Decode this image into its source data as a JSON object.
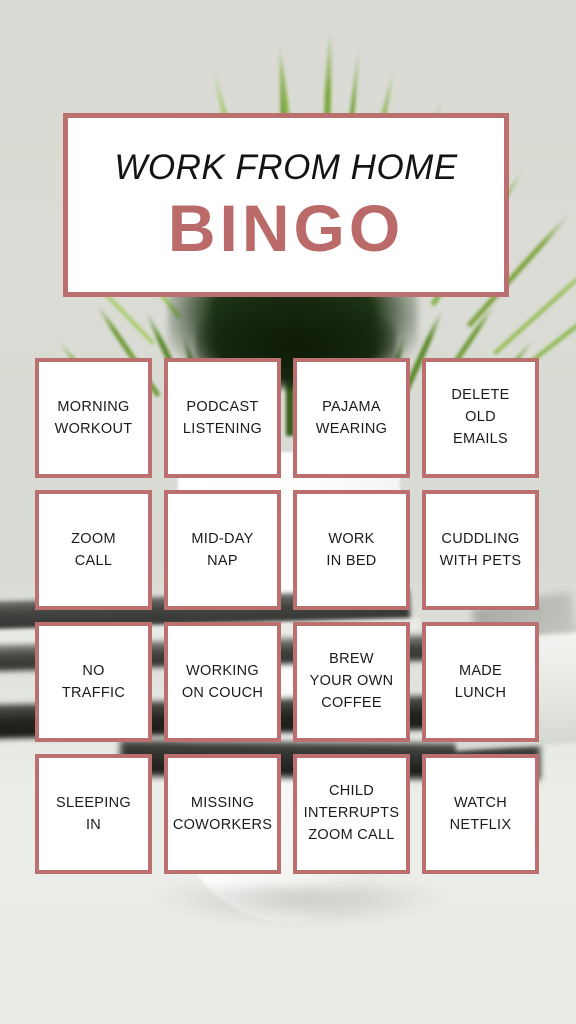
{
  "poster": {
    "title_line1": "WORK FROM HOME",
    "title_line2": "BINGO",
    "accent_color": "#bb6f6f",
    "title_word_color": "#bb6a6a",
    "background_color": "#d7d9d2",
    "card_background": "#ffffff"
  },
  "bingo": {
    "columns": 4,
    "rows": 4,
    "cells": [
      {
        "id": "r1c1",
        "text": "MORNING\nWORKOUT",
        "lines": [
          "MORNING",
          "WORKOUT"
        ]
      },
      {
        "id": "r1c2",
        "text": "PODCAST\nLISTENING",
        "lines": [
          "PODCAST",
          "LISTENING"
        ]
      },
      {
        "id": "r1c3",
        "text": "PAJAMA\nWEARING",
        "lines": [
          "PAJAMA",
          "WEARING"
        ]
      },
      {
        "id": "r1c4",
        "text": "DELETE\nOLD\nEMAILS",
        "lines": [
          "DELETE",
          "OLD",
          "EMAILS"
        ]
      },
      {
        "id": "r2c1",
        "text": "ZOOM\nCALL",
        "lines": [
          "ZOOM",
          "CALL"
        ]
      },
      {
        "id": "r2c2",
        "text": "MID-DAY\nNAP",
        "lines": [
          "MID-DAY",
          "NAP"
        ]
      },
      {
        "id": "r2c3",
        "text": "WORK\nIN BED",
        "lines": [
          "WORK",
          "IN BED"
        ]
      },
      {
        "id": "r2c4",
        "text": "CUDDLING\nWITH PETS",
        "lines": [
          "CUDDLING",
          "WITH PETS"
        ]
      },
      {
        "id": "r3c1",
        "text": "NO\nTRAFFIC",
        "lines": [
          "NO",
          "TRAFFIC"
        ]
      },
      {
        "id": "r3c2",
        "text": "WORKING\nON COUCH",
        "lines": [
          "WORKING",
          "ON COUCH"
        ]
      },
      {
        "id": "r3c3",
        "text": "BREW\nYOUR OWN\nCOFFEE",
        "lines": [
          "BREW",
          "YOUR OWN",
          "COFFEE"
        ]
      },
      {
        "id": "r3c4",
        "text": "MADE\nLUNCH",
        "lines": [
          "MADE",
          "LUNCH"
        ]
      },
      {
        "id": "r4c1",
        "text": "SLEEPING\nIN",
        "lines": [
          "SLEEPING",
          "IN"
        ]
      },
      {
        "id": "r4c2",
        "text": "MISSING\nCOWORKERS",
        "lines": [
          "MISSING",
          "COWORKERS"
        ]
      },
      {
        "id": "r4c3",
        "text": "CHILD\nINTERRUPTS\nZOOM CALL",
        "lines": [
          "CHILD",
          "INTERRUPTS",
          "ZOOM CALL"
        ]
      },
      {
        "id": "r4c4",
        "text": "WATCH\nNETFLIX",
        "lines": [
          "WATCH",
          "NETFLIX"
        ]
      }
    ]
  },
  "background_photo": {
    "description": "blurred potted grass plant on white desk against light gray-green wall",
    "wall_color": "#d9dbd4",
    "desk_color": "#eceee9",
    "pot_color": "#ffffff",
    "foliage_color": "#1d3314",
    "blade_color": "#7ea83f"
  }
}
